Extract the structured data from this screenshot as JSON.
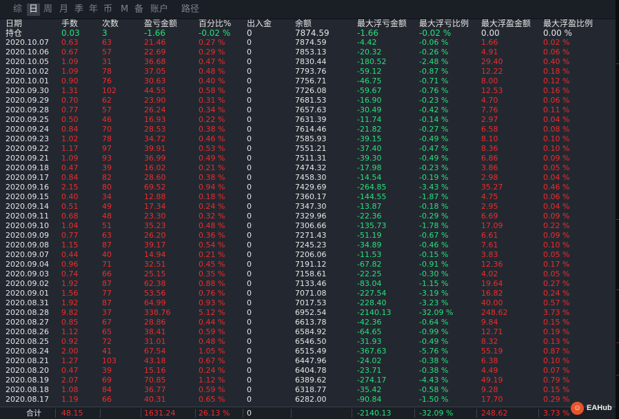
{
  "tabs": [
    "综",
    "日",
    "周",
    "月",
    "季",
    "年",
    "币",
    "M",
    "备",
    "账户",
    "路径"
  ],
  "active_tab": "日",
  "columns": [
    "日期",
    "手数",
    "次数",
    "盈亏金额",
    "百分比%",
    "出入金",
    "余额",
    "最大浮亏金额",
    "最大浮亏比例",
    "最大浮盈金额",
    "最大浮盈比例"
  ],
  "position_row": {
    "label": "持仓",
    "lots": "0.03",
    "count": "3",
    "pnl": "-1.66",
    "pct": "-0.02 %",
    "inout": "0",
    "balance": "7874.59",
    "max_float_loss": "-1.66",
    "max_float_loss_pct": "-0.02 %",
    "max_float_profit": "0.00",
    "max_float_profit_pct": "0.00 %"
  },
  "rows": [
    [
      "2020.10.07",
      "0.63",
      "63",
      "21.46",
      "0.27 %",
      "0",
      "7874.59",
      "-4.42",
      "-0.06 %",
      "1.66",
      "0.02 %"
    ],
    [
      "2020.10.06",
      "0.67",
      "57",
      "22.69",
      "0.29 %",
      "0",
      "7853.13",
      "-20.32",
      "-0.26 %",
      "4.91",
      "0.06 %"
    ],
    [
      "2020.10.05",
      "1.09",
      "31",
      "36.68",
      "0.47 %",
      "0",
      "7830.44",
      "-180.52",
      "-2.48 %",
      "29.40",
      "0.40 %"
    ],
    [
      "2020.10.02",
      "1.09",
      "78",
      "37.05",
      "0.48 %",
      "0",
      "7793.76",
      "-59.12",
      "-0.87 %",
      "12.22",
      "0.18 %"
    ],
    [
      "2020.10.01",
      "0.90",
      "76",
      "30.63",
      "0.40 %",
      "0",
      "7756.71",
      "-46.75",
      "-0.71 %",
      "8.00",
      "0.12 %"
    ],
    [
      "2020.09.30",
      "1.31",
      "102",
      "44.55",
      "0.58 %",
      "0",
      "7726.08",
      "-59.67",
      "-0.76 %",
      "12.53",
      "0.16 %"
    ],
    [
      "2020.09.29",
      "0.70",
      "62",
      "23.90",
      "0.31 %",
      "0",
      "7681.53",
      "-16.90",
      "-0.23 %",
      "4.70",
      "0.06 %"
    ],
    [
      "2020.09.28",
      "0.77",
      "57",
      "26.24",
      "0.34 %",
      "0",
      "7657.63",
      "-30.49",
      "-0.42 %",
      "7.76",
      "0.11 %"
    ],
    [
      "2020.09.25",
      "0.50",
      "46",
      "16.93",
      "0.22 %",
      "0",
      "7631.39",
      "-11.74",
      "-0.14 %",
      "2.97",
      "0.04 %"
    ],
    [
      "2020.09.24",
      "0.84",
      "70",
      "28.53",
      "0.38 %",
      "0",
      "7614.46",
      "-21.82",
      "-0.27 %",
      "6.58",
      "0.08 %"
    ],
    [
      "2020.09.23",
      "1.02",
      "78",
      "34.72",
      "0.46 %",
      "0",
      "7585.93",
      "-39.15",
      "-0.49 %",
      "8.10",
      "0.10 %"
    ],
    [
      "2020.09.22",
      "1.17",
      "97",
      "39.91",
      "0.53 %",
      "0",
      "7551.21",
      "-37.40",
      "-0.47 %",
      "8.36",
      "0.10 %"
    ],
    [
      "2020.09.21",
      "1.09",
      "93",
      "36.99",
      "0.49 %",
      "0",
      "7511.31",
      "-39.30",
      "-0.49 %",
      "6.86",
      "0.09 %"
    ],
    [
      "2020.09.18",
      "0.47",
      "39",
      "16.02",
      "0.21 %",
      "0",
      "7474.32",
      "-17.98",
      "-0.23 %",
      "3.86",
      "0.05 %"
    ],
    [
      "2020.09.17",
      "0.84",
      "82",
      "28.60",
      "0.38 %",
      "0",
      "7458.30",
      "-14.54",
      "-0.19 %",
      "2.98",
      "0.04 %"
    ],
    [
      "2020.09.16",
      "2.15",
      "80",
      "69.52",
      "0.94 %",
      "0",
      "7429.69",
      "-264.85",
      "-3.43 %",
      "35.27",
      "0.46 %"
    ],
    [
      "2020.09.15",
      "0.40",
      "34",
      "12.88",
      "0.18 %",
      "0",
      "7360.17",
      "-144.55",
      "-1.87 %",
      "4.75",
      "0.06 %"
    ],
    [
      "2020.09.14",
      "0.51",
      "49",
      "17.34",
      "0.24 %",
      "0",
      "7347.30",
      "-13.87",
      "-0.18 %",
      "2.95",
      "0.04 %"
    ],
    [
      "2020.09.11",
      "0.68",
      "48",
      "23.30",
      "0.32 %",
      "0",
      "7329.96",
      "-22.36",
      "-0.29 %",
      "6.69",
      "0.09 %"
    ],
    [
      "2020.09.10",
      "1.04",
      "51",
      "35.23",
      "0.48 %",
      "0",
      "7306.66",
      "-135.73",
      "-1.78 %",
      "17.09",
      "0.22 %"
    ],
    [
      "2020.09.09",
      "0.77",
      "63",
      "26.20",
      "0.36 %",
      "0",
      "7271.43",
      "-51.19",
      "-0.67 %",
      "6.61",
      "0.09 %"
    ],
    [
      "2020.09.08",
      "1.15",
      "87",
      "39.17",
      "0.54 %",
      "0",
      "7245.23",
      "-34.89",
      "-0.46 %",
      "7.61",
      "0.10 %"
    ],
    [
      "2020.09.07",
      "0.44",
      "40",
      "14.94",
      "0.21 %",
      "0",
      "7206.06",
      "-11.53",
      "-0.15 %",
      "3.83",
      "0.05 %"
    ],
    [
      "2020.09.04",
      "0.96",
      "71",
      "32.51",
      "0.45 %",
      "0",
      "7191.12",
      "-67.82",
      "-0.91 %",
      "12.36",
      "0.17 %"
    ],
    [
      "2020.09.03",
      "0.74",
      "66",
      "25.15",
      "0.35 %",
      "0",
      "7158.61",
      "-22.25",
      "-0.30 %",
      "4.02",
      "0.05 %"
    ],
    [
      "2020.09.02",
      "1.92",
      "87",
      "62.38",
      "0.88 %",
      "0",
      "7133.46",
      "-83.04",
      "-1.15 %",
      "19.64",
      "0.27 %"
    ],
    [
      "2020.09.01",
      "1.56",
      "77",
      "53.56",
      "0.76 %",
      "0",
      "7071.08",
      "-227.54",
      "-3.19 %",
      "16.82",
      "0.24 %"
    ],
    [
      "2020.08.31",
      "1.92",
      "87",
      "64.99",
      "0.93 %",
      "0",
      "7017.53",
      "-228.40",
      "-3.23 %",
      "40.00",
      "0.57 %"
    ],
    [
      "2020.08.28",
      "9.82",
      "37",
      "338.76",
      "5.12 %",
      "0",
      "6952.54",
      "-2140.13",
      "-32.09 %",
      "248.62",
      "3.73 %"
    ],
    [
      "2020.08.27",
      "0.85",
      "67",
      "28.86",
      "0.44 %",
      "0",
      "6613.78",
      "-42.36",
      "-0.64 %",
      "9.84",
      "0.15 %"
    ],
    [
      "2020.08.26",
      "1.12",
      "65",
      "38.41",
      "0.59 %",
      "0",
      "6584.92",
      "-64.65",
      "-0.99 %",
      "12.71",
      "0.19 %"
    ],
    [
      "2020.08.25",
      "0.92",
      "72",
      "31.01",
      "0.48 %",
      "0",
      "6546.50",
      "-31.93",
      "-0.49 %",
      "8.32",
      "0.13 %"
    ],
    [
      "2020.08.24",
      "2.00",
      "41",
      "67.54",
      "1.05 %",
      "0",
      "6515.49",
      "-367.63",
      "-5.76 %",
      "55.19",
      "0.87 %"
    ],
    [
      "2020.08.21",
      "1.27",
      "103",
      "43.18",
      "0.67 %",
      "0",
      "6447.96",
      "-24.02",
      "-0.38 %",
      "6.38",
      "0.10 %"
    ],
    [
      "2020.08.20",
      "0.47",
      "39",
      "15.16",
      "0.24 %",
      "0",
      "6404.78",
      "-23.71",
      "-0.38 %",
      "4.49",
      "0.07 %"
    ],
    [
      "2020.08.19",
      "2.07",
      "69",
      "70.85",
      "1.12 %",
      "0",
      "6389.62",
      "-274.17",
      "-4.43 %",
      "49.19",
      "0.79 %"
    ],
    [
      "2020.08.18",
      "1.08",
      "84",
      "36.77",
      "0.59 %",
      "0",
      "6318.77",
      "-35.42",
      "-0.58 %",
      "9.28",
      "0.15 %"
    ],
    [
      "2020.08.17",
      "1.19",
      "66",
      "40.31",
      "0.65 %",
      "0",
      "6282.00",
      "-90.84",
      "-1.50 %",
      "17.70",
      "0.29 %"
    ]
  ],
  "total_row": {
    "label": "合计",
    "lots": "48.15",
    "pnl": "1631.24",
    "pct": "26.13 %",
    "inout": "0",
    "max_float_loss": "-2140.13",
    "max_float_loss_pct": "-32.09 %",
    "max_float_profit": "248.62",
    "max_float_profit_pct": "3.73 %"
  },
  "logo": {
    "icon_name": "eahub-logo-icon",
    "text": "EAHub"
  },
  "colors": {
    "profit": "#ee2c2c",
    "loss": "#27e17a",
    "background": "#232830"
  }
}
